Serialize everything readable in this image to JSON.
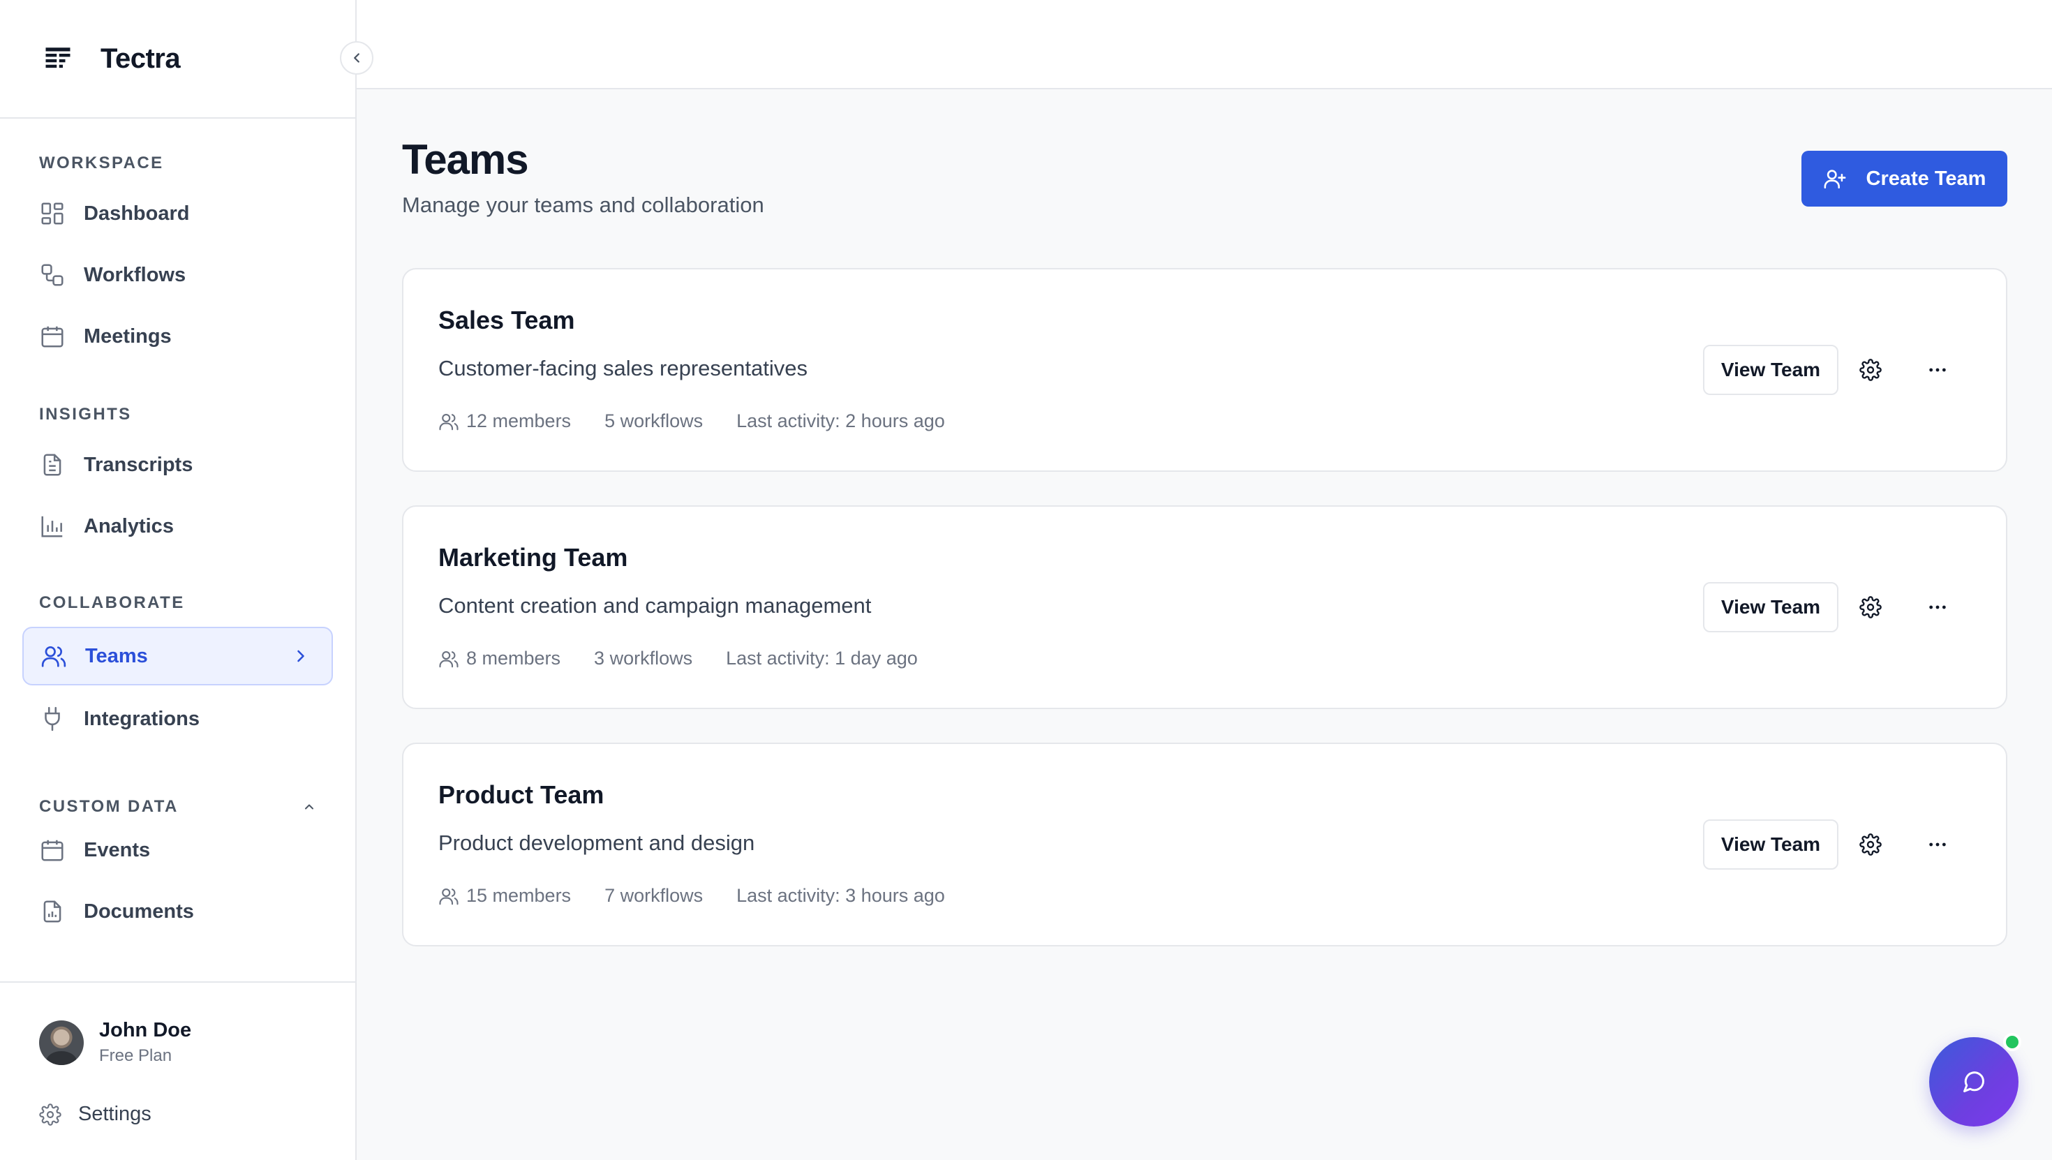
{
  "app": {
    "name": "Tectra"
  },
  "sidebar": {
    "sections": [
      {
        "label": "WORKSPACE",
        "items": [
          {
            "label": "Dashboard",
            "icon": "dashboard-icon"
          },
          {
            "label": "Workflows",
            "icon": "workflows-icon"
          },
          {
            "label": "Meetings",
            "icon": "calendar-icon"
          }
        ]
      },
      {
        "label": "INSIGHTS",
        "items": [
          {
            "label": "Transcripts",
            "icon": "document-icon"
          },
          {
            "label": "Analytics",
            "icon": "bar-chart-icon"
          }
        ]
      },
      {
        "label": "COLLABORATE",
        "items": [
          {
            "label": "Teams",
            "icon": "users-icon",
            "active": true
          },
          {
            "label": "Integrations",
            "icon": "plug-icon"
          }
        ]
      },
      {
        "label": "CUSTOM DATA",
        "items": [
          {
            "label": "Events",
            "icon": "calendar-icon"
          },
          {
            "label": "Documents",
            "icon": "file-chart-icon"
          }
        ]
      }
    ],
    "user": {
      "name": "John Doe",
      "plan": "Free Plan"
    },
    "settings_label": "Settings"
  },
  "page": {
    "title": "Teams",
    "subtitle": "Manage your teams and collaboration",
    "create_button": "Create Team",
    "view_button": "View Team"
  },
  "teams": [
    {
      "name": "Sales Team",
      "description": "Customer-facing sales representatives",
      "members": "12 members",
      "workflows": "5 workflows",
      "activity": "Last activity: 2 hours ago"
    },
    {
      "name": "Marketing Team",
      "description": "Content creation and campaign management",
      "members": "8 members",
      "workflows": "3 workflows",
      "activity": "Last activity: 1 day ago"
    },
    {
      "name": "Product Team",
      "description": "Product development and design",
      "members": "15 members",
      "workflows": "7 workflows",
      "activity": "Last activity: 3 hours ago"
    }
  ],
  "colors": {
    "accent": "#2f5be0",
    "active_bg": "#eef2ff",
    "online": "#22c55e"
  }
}
